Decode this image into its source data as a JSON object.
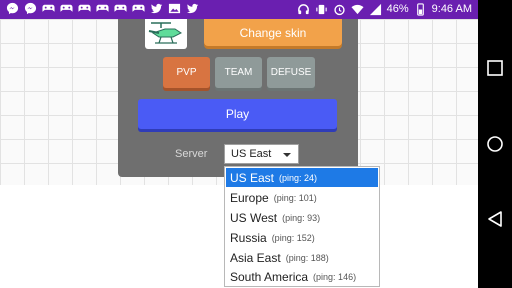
{
  "status_bar": {
    "battery_percent": "46%",
    "time": "9:46 AM",
    "notification_icons": [
      "messenger-icon",
      "messenger-icon",
      "gamepad-icon",
      "gamepad-icon",
      "gamepad-icon",
      "gamepad-icon",
      "gamepad-icon",
      "gamepad-icon",
      "twitter-icon",
      "image-icon",
      "twitter-icon"
    ],
    "system_icons": [
      "headset-icon",
      "vibrate-icon",
      "alarm-icon",
      "wifi-icon",
      "signal-icon",
      "battery-icon"
    ],
    "color": "#6a1fb0"
  },
  "menu": {
    "change_skin_label": "Change skin",
    "modes": [
      {
        "label": "PVP",
        "selected": true
      },
      {
        "label": "TEAM",
        "selected": false
      },
      {
        "label": "DEFUSE",
        "selected": false
      }
    ],
    "play_label": "Play",
    "server_label": "Server",
    "server_selected": "US East"
  },
  "dropdown": {
    "options": [
      {
        "name": "US East",
        "ping": "(ping: 24)",
        "selected": true
      },
      {
        "name": "Europe",
        "ping": "(ping: 101)",
        "selected": false
      },
      {
        "name": "US West",
        "ping": "(ping: 93)",
        "selected": false
      },
      {
        "name": "Russia",
        "ping": "(ping: 152)",
        "selected": false
      },
      {
        "name": "Asia East",
        "ping": "(ping: 188)",
        "selected": false
      },
      {
        "name": "South America",
        "ping": "(ping: 146)",
        "selected": false
      }
    ]
  },
  "colors": {
    "accent_orange": "#f2a24a",
    "pvp": "#d87441",
    "mode_inactive": "#8f9a99",
    "play": "#4a5bf5",
    "dropdown_highlight": "#1e7ae6"
  },
  "nav_bar": {
    "buttons": [
      "recents-square-icon",
      "home-circle-icon",
      "back-triangle-icon"
    ]
  }
}
